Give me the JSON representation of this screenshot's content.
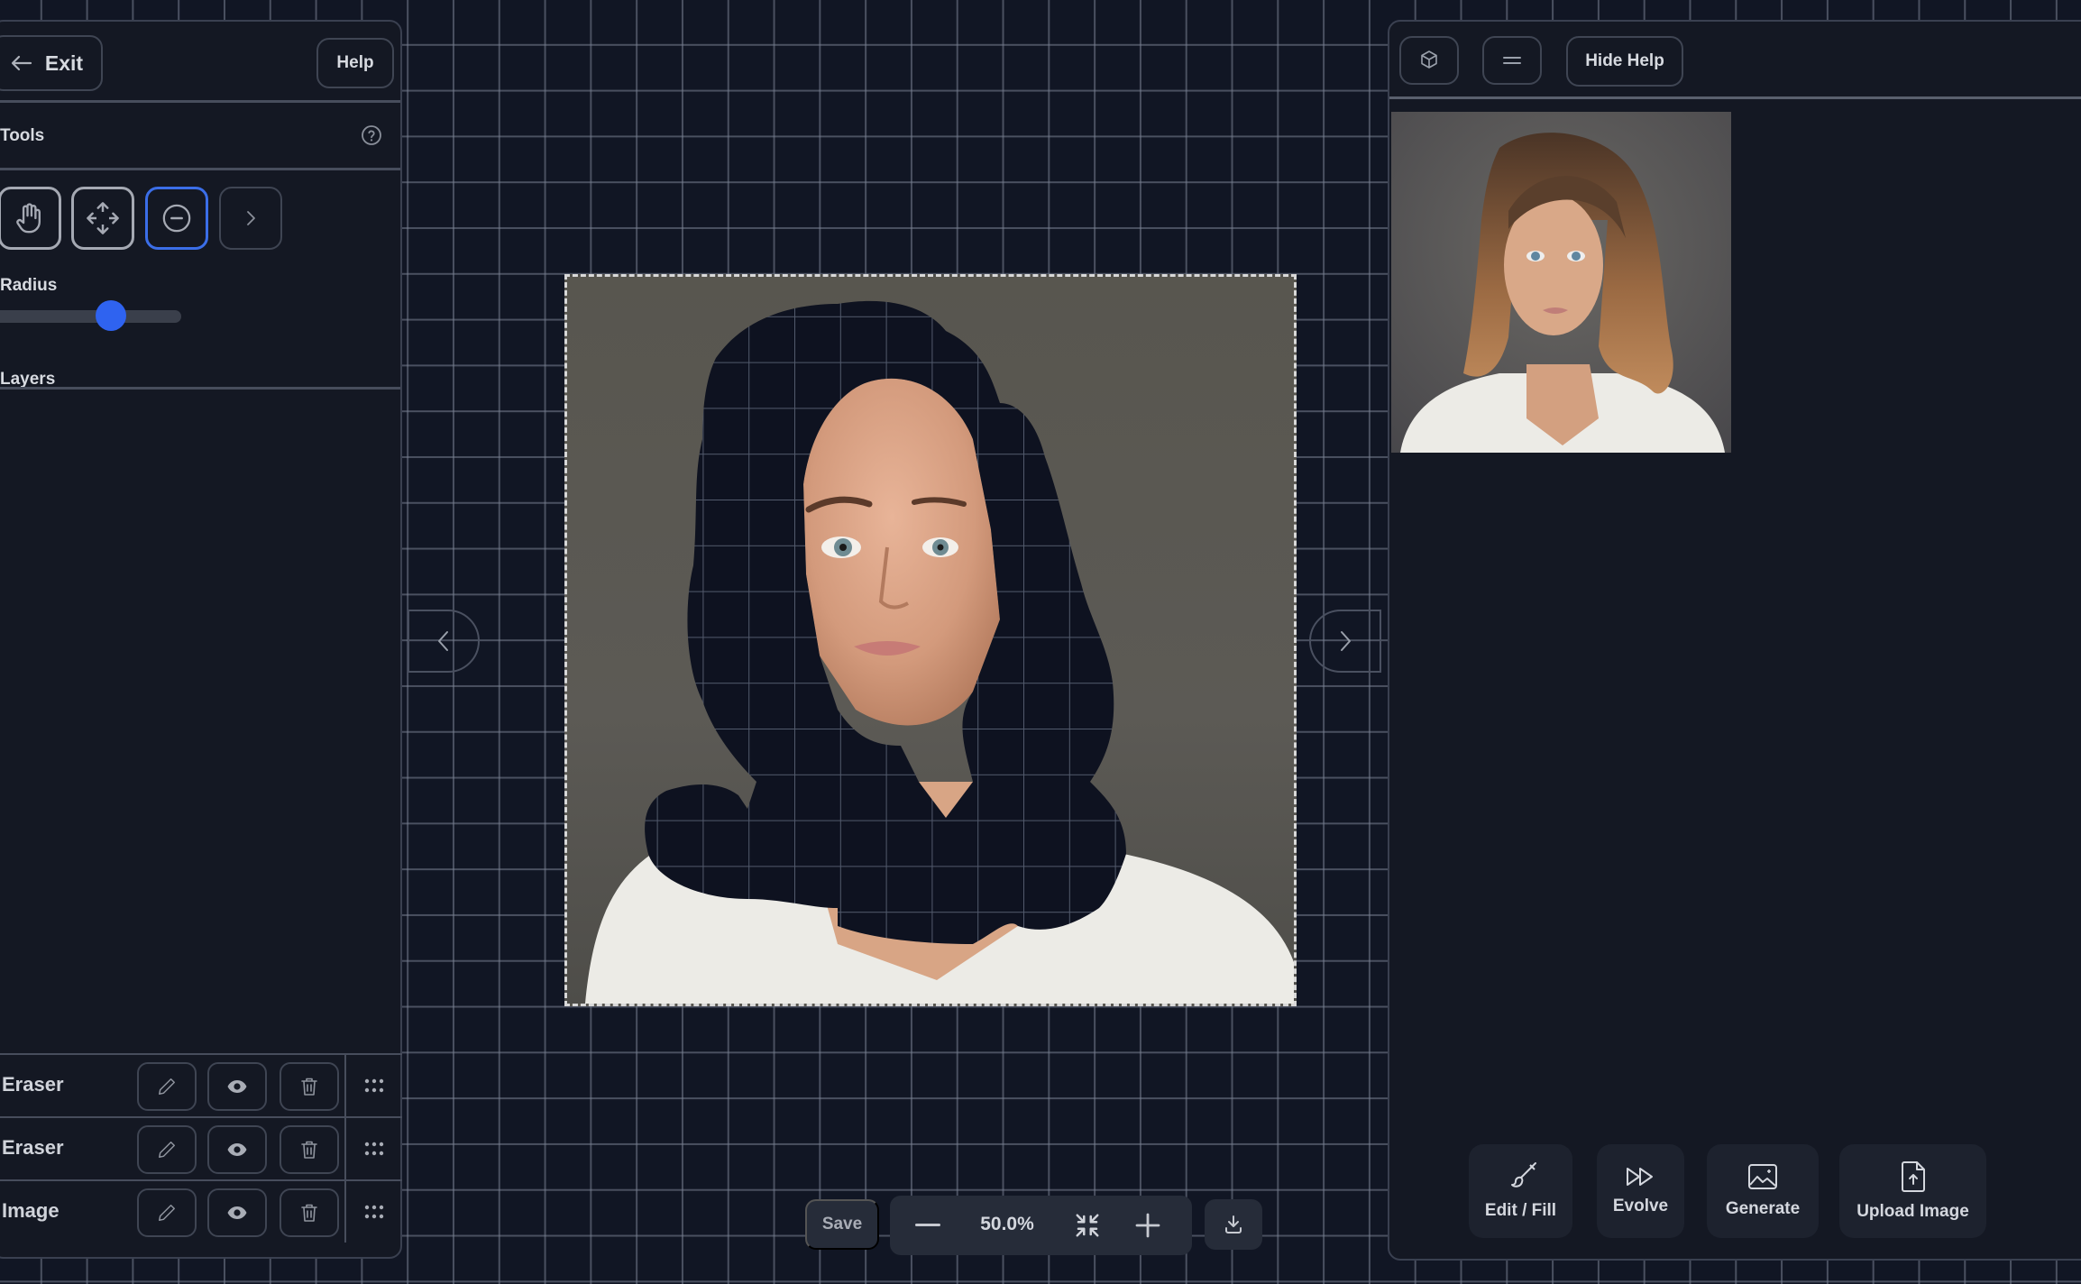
{
  "left_panel": {
    "exit_label": "Exit",
    "help_label": "Help",
    "tools_heading": "Tools",
    "tools": [
      {
        "name": "hand-icon",
        "label": "Pan"
      },
      {
        "name": "move-icon",
        "label": "Move"
      },
      {
        "name": "eraser-circle-icon",
        "label": "Eraser",
        "active": true
      },
      {
        "name": "chevron-right-icon",
        "label": "More"
      }
    ],
    "radius_label": "Radius",
    "radius_value": 0.58,
    "layers_heading": "Layers",
    "layers": [
      {
        "name": "Eraser"
      },
      {
        "name": "Eraser"
      },
      {
        "name": "Image"
      }
    ]
  },
  "canvas": {
    "zoom": "50.0%",
    "save_label": "Save"
  },
  "right_panel": {
    "hide_help_label": "Hide Help",
    "actions": [
      {
        "label": "Edit / Fill",
        "icon": "paintbrush-icon"
      },
      {
        "label": "Evolve",
        "icon": "fast-forward-icon"
      },
      {
        "label": "Generate",
        "icon": "image-sparkle-icon"
      },
      {
        "label": "Upload Image",
        "icon": "file-upload-icon"
      }
    ]
  },
  "colors": {
    "accent": "#2f63f0",
    "background": "#111624",
    "panel": "#141823"
  }
}
